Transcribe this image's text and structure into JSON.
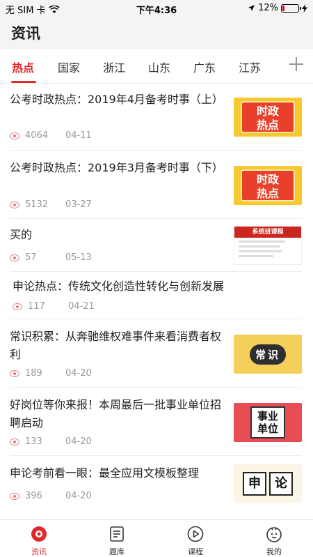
{
  "status_bar": {
    "carrier": "无 SIM 卡",
    "time": "下午4:36",
    "battery": "12%",
    "battery_level": 0.12
  },
  "header": {
    "title": "资讯"
  },
  "tabs": [
    {
      "label": "热点",
      "active": true
    },
    {
      "label": "国家",
      "active": false
    },
    {
      "label": "浙江",
      "active": false
    },
    {
      "label": "山东",
      "active": false
    },
    {
      "label": "广东",
      "active": false
    },
    {
      "label": "江苏",
      "active": false
    }
  ],
  "news": [
    {
      "title": "公考时政热点：2019年4月备考时事（上）",
      "views": "4064",
      "date": "04-11",
      "thumb": "hot",
      "thumb_text": [
        "时政",
        "热点"
      ]
    },
    {
      "title": "公考时政热点：2019年3月备考时事（下）",
      "views": "5132",
      "date": "03-27",
      "thumb": "hot",
      "thumb_text": [
        "时政",
        "热点"
      ]
    },
    {
      "title": "买的",
      "views": "57",
      "date": "05-13",
      "thumb": "course",
      "thumb_text": [
        "系统班课程"
      ]
    },
    {
      "title": "申论热点：传统文化创造性转化与创新发展",
      "views": "117",
      "date": "04-21",
      "thumb": "none"
    },
    {
      "title": "常识积累：从奔驰维权难事件来看消费者权利",
      "views": "189",
      "date": "04-20",
      "thumb": "changshi",
      "thumb_text": [
        "常识"
      ]
    },
    {
      "title": "好岗位等你来报！本周最后一批事业单位招聘启动",
      "views": "133",
      "date": "04-20",
      "thumb": "shiye",
      "thumb_text": [
        "事业",
        "单位"
      ]
    },
    {
      "title": "申论考前看一眼：最全应用文模板整理",
      "views": "396",
      "date": "04-20",
      "thumb": "shenlun",
      "thumb_text": [
        "申",
        "论"
      ]
    }
  ],
  "tabbar": [
    {
      "label": "资讯",
      "icon": "news-icon",
      "active": true
    },
    {
      "label": "题库",
      "icon": "question-bank-icon",
      "active": false
    },
    {
      "label": "课程",
      "icon": "course-play-icon",
      "active": false
    },
    {
      "label": "我的",
      "icon": "profile-icon",
      "active": false
    }
  ],
  "colors": {
    "accent": "#e02a2a",
    "header_bg": "#f4f4f4",
    "meta": "#999999"
  }
}
